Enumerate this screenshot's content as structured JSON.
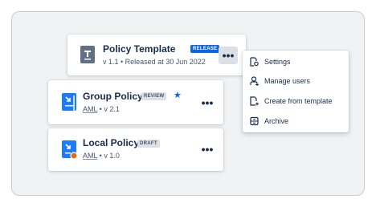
{
  "cards": [
    {
      "title": "Policy Template",
      "badge": "RELEASE",
      "subtitle": "v 1.1 • Released at 30 Jun 2022",
      "more": "•••",
      "icon": "text-document-icon"
    },
    {
      "title": "Group Policy",
      "badge": "REVIEW",
      "subtitle_link": "AML",
      "subtitle_rest": " • v 2.1",
      "more": "•••",
      "icon": "document-review-icon",
      "starred": true
    },
    {
      "title": "Local Policy",
      "badge": "DRAFT",
      "subtitle_link": "AML",
      "subtitle_rest": " • v 1.0",
      "more": "•••",
      "icon": "document-draft-icon"
    }
  ],
  "menu": {
    "items": [
      {
        "label": "Settings",
        "icon": "settings-document-icon"
      },
      {
        "label": "Manage users",
        "icon": "manage-users-icon"
      },
      {
        "label": "Create from template",
        "icon": "create-from-template-icon"
      },
      {
        "label": "Archive",
        "icon": "archive-icon"
      }
    ]
  },
  "colors": {
    "accent": "#0c66e4",
    "draft_dot": "#e56910",
    "template_icon": "#626f86",
    "policy_icon": "#1d7afc"
  }
}
